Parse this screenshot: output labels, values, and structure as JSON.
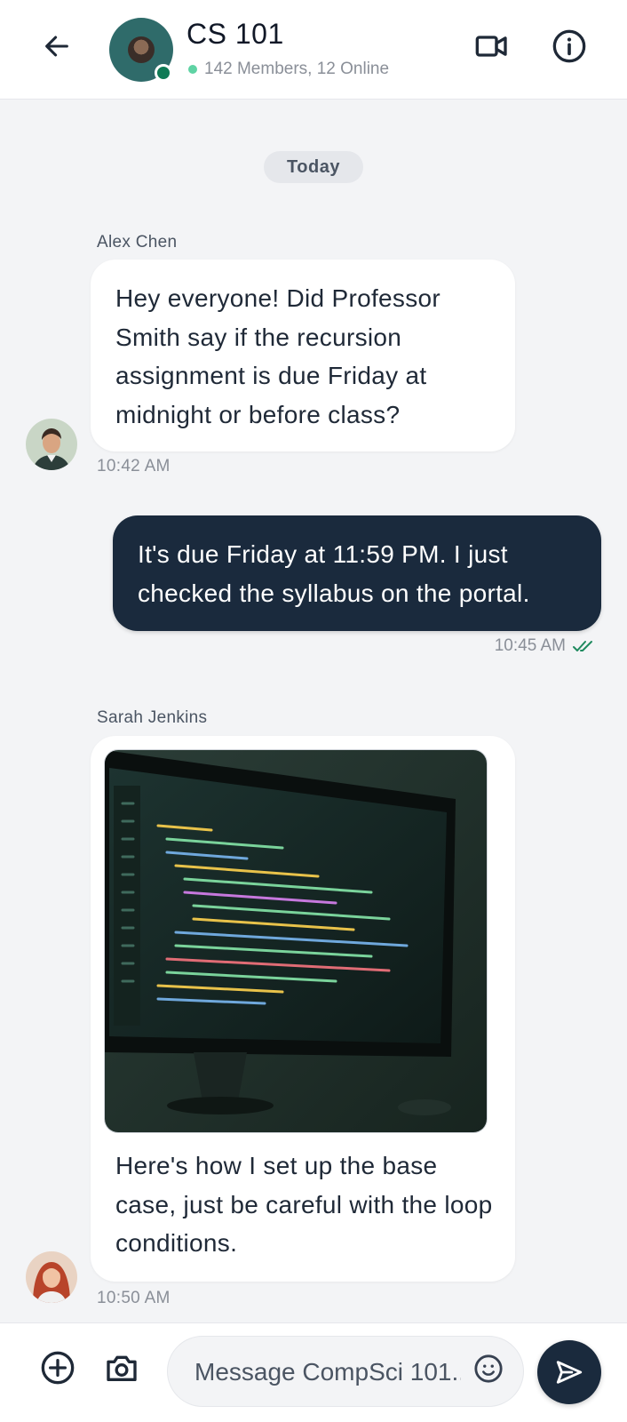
{
  "header": {
    "title": "CS 101",
    "status": "142 Members, 12 Online",
    "icons": {
      "back": "arrow-left-icon",
      "video": "video-call-icon",
      "info": "info-icon"
    }
  },
  "date_divider": "Today",
  "messages": [
    {
      "sender": "Alex Chen",
      "text": "Hey everyone! Did Professor Smith say if the recursion assignment is due Friday at midnight or before class?",
      "time": "10:42 AM",
      "direction": "incoming"
    },
    {
      "text": "It's due Friday at 11:59 PM. I just checked the syllabus on the portal.",
      "time": "10:45 AM",
      "direction": "outgoing",
      "read": true
    },
    {
      "sender": "Sarah Jenkins",
      "has_image": true,
      "image_subject": "computer monitor with code",
      "text": "Here's how I set up the base case, just be careful with the loop conditions.",
      "time": "10:50 AM",
      "direction": "incoming"
    }
  ],
  "composer": {
    "placeholder": "Message CompSci 101...",
    "icons": {
      "add": "plus-circle-icon",
      "camera": "camera-icon",
      "emoji": "emoji-icon",
      "send": "send-icon"
    }
  },
  "colors": {
    "outgoing_bubble": "#1a2a3d",
    "incoming_bubble": "#ffffff",
    "background": "#f3f4f6",
    "online": "#0f7a55",
    "read_check": "#1f8a5f"
  }
}
